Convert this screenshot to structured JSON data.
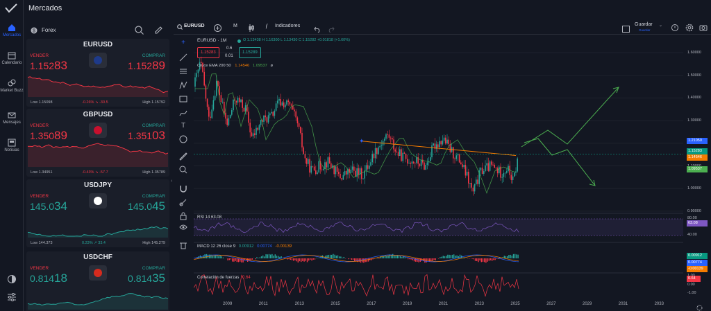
{
  "app": {
    "title": "Mercados"
  },
  "nav": {
    "items": [
      {
        "label": "Mercados"
      },
      {
        "label": "Calendario"
      },
      {
        "label": "Market Buzz"
      },
      {
        "label": "Mensajes"
      },
      {
        "label": "Noticias"
      }
    ]
  },
  "panel": {
    "header": "Forex",
    "cards": [
      {
        "symbol": "EURUSD",
        "sell_label": "VENDER",
        "buy_label": "COMPRAR",
        "bid_main": "1.152",
        "bid_big": "83",
        "ask_main": "1.152",
        "ask_big": "89",
        "low": "Low 1.15098",
        "high": "High 1.15792",
        "change": "-0.26% ↘ -30.5",
        "trend": "down",
        "flag_color": "#1e3a8a"
      },
      {
        "symbol": "GBPUSD",
        "sell_label": "VENDER",
        "buy_label": "COMPRAR",
        "bid_main": "1.350",
        "bid_big": "89",
        "ask_main": "1.351",
        "ask_big": "03",
        "low": "Low 1.34951",
        "high": "High 1.35789",
        "change": "-0.43% ↘ -57.7",
        "trend": "down",
        "flag_color": "#c8102e"
      },
      {
        "symbol": "USDJPY",
        "sell_label": "VENDER",
        "buy_label": "COMPRAR",
        "bid_main": "145.0",
        "bid_big": "34",
        "ask_main": "145.0",
        "ask_big": "45",
        "low": "Low 144.373",
        "high": "High 145.279",
        "change": "0.23% ↗ 33.4",
        "trend": "up",
        "flag_color": "#ffffff"
      },
      {
        "symbol": "USDCHF",
        "sell_label": "VENDER",
        "buy_label": "COMPRAR",
        "bid_main": "0.814",
        "bid_big": "18",
        "ask_main": "0.814",
        "ask_big": "35",
        "low": "",
        "high": "",
        "change": "",
        "trend": "up",
        "flag_color": "#d52b1e"
      }
    ]
  },
  "chart_header": {
    "symbol": "EURUSD",
    "interval": "M",
    "indicators_label": "Indicadores",
    "save_label": "Guardar",
    "save_sub": "Guardar"
  },
  "legend": {
    "title": "EURUSD · 1M",
    "ohlc": "O 1.13438  H 1.16300  L 1.13430  C 1.15282  +0.01818 (+1.60%)",
    "sell_price": "1.15283",
    "spread_top": "0.6",
    "spread_bottom": "0.01",
    "buy_price": "1.15289",
    "ema_label": "Cruce EMA 200 50",
    "ema_val1": "1.14546",
    "ema_val2": "1.09537",
    "ema_tail": "ø",
    "rsi_label": "RSI 14  63.08",
    "macd_label": "MACD 12 26 close 9",
    "macd_v1": "0.00912",
    "macd_v2": "0.00774",
    "macd_v3": "-0.00139",
    "cf_label": "Correlación de fuerzas",
    "cf_val": "0.64"
  },
  "price_axis": {
    "ticks": [
      "1.60000",
      "1.50000",
      "1.40000",
      "1.30000",
      "1.20000",
      "1.10000",
      "1.00000",
      "0.90000"
    ],
    "tags": [
      {
        "value": "1.21050",
        "color": "#2962ff"
      },
      {
        "value": "1.15283",
        "color": "#089981"
      },
      {
        "value": "1.14546",
        "color": "#f57c00"
      },
      {
        "value": "1.09537",
        "color": "#4caf50"
      }
    ],
    "rsi_ticks": [
      "80.00",
      "40.00"
    ],
    "rsi_tag": "63.08",
    "macd_tags": [
      "0.00912",
      "0.00774",
      "-0.00139"
    ],
    "cf_ticks": [
      "1.00",
      "0.00",
      "-1.00"
    ],
    "cf_tag": "0.64"
  },
  "time_axis": {
    "ticks": [
      "2009",
      "2011",
      "2013",
      "2015",
      "2017",
      "2019",
      "2021",
      "2023",
      "2025",
      "2027",
      "2029",
      "2031",
      "2033"
    ]
  },
  "colors": {
    "bg": "#131722",
    "up": "#26a69a",
    "down": "#f23645",
    "accent": "#2962ff"
  }
}
